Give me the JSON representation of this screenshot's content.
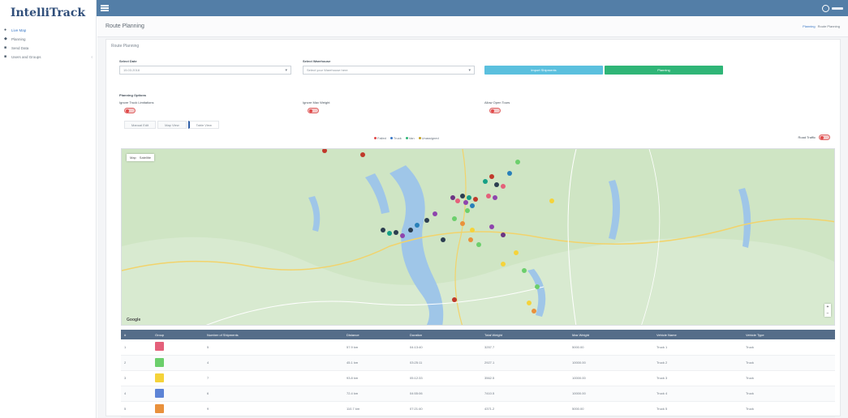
{
  "brand": "IntelliTrack",
  "sidebar": {
    "items": [
      {
        "label": "Live Map",
        "icon": "map-marker-icon",
        "active": true
      },
      {
        "label": "Planning",
        "icon": "route-icon",
        "active": false
      },
      {
        "label": "Send Data",
        "icon": "send-icon",
        "active": false
      },
      {
        "label": "Users and Groups",
        "icon": "users-icon",
        "active": false
      }
    ]
  },
  "header": {
    "menu_icon": "hamburger-icon",
    "user_icon": "user-circle-icon"
  },
  "page": {
    "title": "Route Planning",
    "breadcrumb": [
      "Planning",
      "Route Planning"
    ],
    "panel_title": "Route Planning"
  },
  "form": {
    "date_label": "Select Date",
    "date_value": "15.03.2018",
    "warehouse_label": "Select Warehouse",
    "warehouse_placeholder": "Select your Warehouse here",
    "import_button": "Import Shipments",
    "planning_button": "Planning"
  },
  "options": {
    "title": "Planning Options",
    "items": [
      {
        "label": "Ignore Truck Limitations"
      },
      {
        "label": "Ignore Max Weight"
      },
      {
        "label": "Allow Open Tours"
      }
    ]
  },
  "tabs": [
    "Manual Edit",
    "Map View",
    "Table View"
  ],
  "legend": [
    {
      "label": "Failed",
      "color": "#e04848"
    },
    {
      "label": "Truck",
      "color": "#3a78c6"
    },
    {
      "label": "Van",
      "color": "#2fb577"
    },
    {
      "label": "Unassigned",
      "color": "#c4a020"
    }
  ],
  "road_traffic_label": "Road Traffic",
  "map": {
    "type_buttons": [
      "Map",
      "Satellite"
    ],
    "zoom_in": "+",
    "zoom_out": "−",
    "google_logo": "Google"
  },
  "table": {
    "columns": [
      "#",
      "Group",
      "Number of Shipments",
      "Distance",
      "Duration",
      "Total Weight",
      "Max Weight",
      "Vehicle Name",
      "Vehicle Type"
    ],
    "rows": [
      {
        "id": "1",
        "color": "#e4607a",
        "shipments": "5",
        "distance": "57.9 km",
        "duration": "04:13:40",
        "total_weight": "3257.7",
        "max_weight": "5000.00",
        "vehicle_name": "Truck 1",
        "vehicle_type": "Truck"
      },
      {
        "id": "2",
        "color": "#6ccf6c",
        "shipments": "4",
        "distance": "45.1 km",
        "duration": "03:25:11",
        "total_weight": "2927.1",
        "max_weight": "10000.00",
        "vehicle_name": "Truck 2",
        "vehicle_type": "Truck"
      },
      {
        "id": "3",
        "color": "#f5d33a",
        "shipments": "7",
        "distance": "93.8 km",
        "duration": "05:12:33",
        "total_weight": "3562.5",
        "max_weight": "10000.00",
        "vehicle_name": "Truck 3",
        "vehicle_type": "Truck"
      },
      {
        "id": "4",
        "color": "#5d84d6",
        "shipments": "6",
        "distance": "72.4 km",
        "duration": "04:55:06",
        "total_weight": "7410.5",
        "max_weight": "10000.00",
        "vehicle_name": "Truck 4",
        "vehicle_type": "Truck"
      },
      {
        "id": "5",
        "color": "#e9913c",
        "shipments": "9",
        "distance": "110.7 km",
        "duration": "07:21:40",
        "total_weight": "4371.2",
        "max_weight": "5000.00",
        "vehicle_name": "Truck 5",
        "vehicle_type": "Truck"
      }
    ]
  }
}
